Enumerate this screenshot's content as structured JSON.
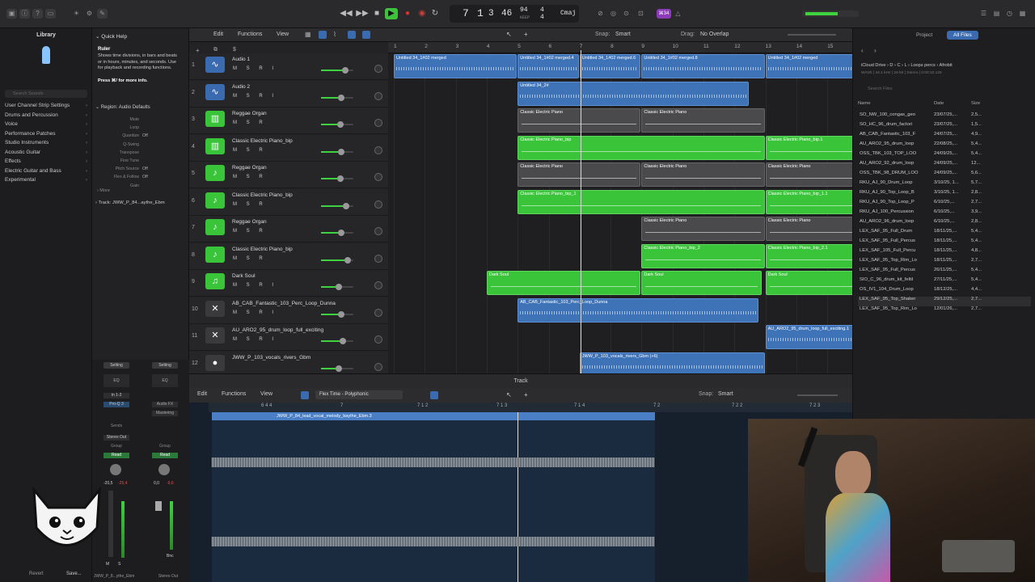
{
  "control_bar": {
    "lcd": {
      "bar": "7",
      "beat": "1",
      "div": "3",
      "tempo": "46",
      "tempo_value": "94",
      "tempo_label": "KEEP",
      "sig_top": "4",
      "sig_bottom": "4",
      "key": "Cmaj"
    },
    "badge": "⌘34"
  },
  "library": {
    "title": "Library",
    "search_placeholder": "Search Sounds",
    "items": [
      "User Channel Strip Settings",
      "Drums and Percussion",
      "Voice",
      "Performance Patches",
      "Studio Instruments",
      "Acoustic Guitar",
      "Effects",
      "Electric Guitar and Bass",
      "Experimental"
    ],
    "footer": {
      "revert": "Revert",
      "save": "Save..."
    }
  },
  "quick_help": {
    "title": "Quick Help",
    "heading": "Ruler",
    "body": "Shows time divisions, in bars and beats or in hours, minutes, and seconds. Use for playback and recording functions.",
    "more": "Press ⌘/ for more info.",
    "region_label": "Region: Audio Defaults",
    "params": [
      {
        "label": "Mute",
        "value": ""
      },
      {
        "label": "Loop",
        "value": ""
      },
      {
        "label": "Quantize",
        "value": "Off"
      },
      {
        "label": "Q-Swing",
        "value": ""
      },
      {
        "label": "Transpose",
        "value": ""
      },
      {
        "label": "Fine Tune",
        "value": ""
      },
      {
        "label": "Pitch Source",
        "value": "Off"
      },
      {
        "label": "Flex & Follow",
        "value": "Off"
      },
      {
        "label": "Gain",
        "value": ""
      }
    ],
    "more_label": "More",
    "track_label": "Track: JWW_P_84...aythe_Ebm"
  },
  "tracks_toolbar": {
    "edit": "Edit",
    "functions": "Functions",
    "view": "View",
    "snap_label": "Snap:",
    "snap_value": "Smart",
    "drag_label": "Drag:",
    "drag_value": "No Overlap"
  },
  "ruler_ticks": [
    "1",
    "2",
    "3",
    "4",
    "5",
    "6",
    "7",
    "8",
    "9",
    "10",
    "11",
    "12",
    "13",
    "14",
    "15"
  ],
  "tracks": [
    {
      "num": "1",
      "name": "Audio 1",
      "btns": "M S R I",
      "kind": "audio"
    },
    {
      "num": "2",
      "name": "Audio 2",
      "btns": "M S R I",
      "kind": "audio"
    },
    {
      "num": "3",
      "name": "Reggae Organ",
      "btns": "M S R",
      "kind": "keys"
    },
    {
      "num": "4",
      "name": "Classic Electric Piano_bip",
      "btns": "M S R",
      "kind": "keys"
    },
    {
      "num": "5",
      "name": "Reggae Organ",
      "btns": "M S R",
      "kind": "note"
    },
    {
      "num": "6",
      "name": "Classic Electric Piano_bip",
      "btns": "M S R",
      "kind": "note"
    },
    {
      "num": "7",
      "name": "Reggae Organ",
      "btns": "M S R",
      "kind": "note"
    },
    {
      "num": "8",
      "name": "Classic Electric Piano_bip",
      "btns": "M S R",
      "kind": "note"
    },
    {
      "num": "9",
      "name": "Dark Soul",
      "btns": "M S R I",
      "kind": "guitar"
    },
    {
      "num": "10",
      "name": "AB_CAB_Fantastic_103_Perc_Loop_Dunna",
      "btns": "M S R I",
      "kind": "loop"
    },
    {
      "num": "11",
      "name": "AU_ARO2_95_drum_loop_full_exciting",
      "btns": "M S R I",
      "kind": "loop"
    },
    {
      "num": "12",
      "name": "JWW_P_103_vocals_rivers_Gbm",
      "btns": "",
      "kind": "mic"
    }
  ],
  "regions": [
    {
      "row": 0,
      "from": 1,
      "to": 5,
      "color": "blue",
      "label": "Untitled 34_1#02 merged"
    },
    {
      "row": 0,
      "from": 5,
      "to": 7,
      "color": "blue",
      "label": "Untitled 34_1#02 merged.4"
    },
    {
      "row": 0,
      "from": 7,
      "to": 9,
      "color": "blue",
      "label": "Untitled 34_1#02 merged.6"
    },
    {
      "row": 0,
      "from": 9,
      "to": 13,
      "color": "blue",
      "label": "Untitled 34_1#02 merged.8"
    },
    {
      "row": 0,
      "from": 13,
      "to": 16,
      "color": "blue",
      "label": "Untitled 34_1#02 merged"
    },
    {
      "row": 1,
      "from": 5,
      "to": 12.5,
      "color": "blue",
      "label": "Untitled 34_2#"
    },
    {
      "row": 2,
      "from": 5,
      "to": 9,
      "color": "grey",
      "label": "Classic Electric Piano"
    },
    {
      "row": 2,
      "from": 9,
      "to": 13,
      "color": "grey",
      "label": "Classic Electric Piano"
    },
    {
      "row": 3,
      "from": 5,
      "to": 13,
      "color": "green",
      "label": "Classic Electric Piano_bip"
    },
    {
      "row": 3,
      "from": 13,
      "to": 16,
      "color": "green",
      "label": "Classic Electric Piano_bip.1"
    },
    {
      "row": 4,
      "from": 5,
      "to": 9,
      "color": "grey",
      "label": "Classic Electric Piano"
    },
    {
      "row": 4,
      "from": 9,
      "to": 13,
      "color": "grey",
      "label": "Classic Electric Piano"
    },
    {
      "row": 4,
      "from": 13,
      "to": 16,
      "color": "grey",
      "label": "Classic Electric Piano"
    },
    {
      "row": 5,
      "from": 5,
      "to": 13,
      "color": "green",
      "label": "Classic Electric Piano_bip_1"
    },
    {
      "row": 5,
      "from": 13,
      "to": 16,
      "color": "green",
      "label": "Classic Electric Piano_bip_1.1"
    },
    {
      "row": 6,
      "from": 9,
      "to": 13,
      "color": "grey",
      "label": "Classic Electric Piano"
    },
    {
      "row": 6,
      "from": 13,
      "to": 16,
      "color": "grey",
      "label": "Classic Electric Piano"
    },
    {
      "row": 7,
      "from": 9,
      "to": 13,
      "color": "green",
      "label": "Classic Electric Piano_bip_2"
    },
    {
      "row": 7,
      "from": 13,
      "to": 16,
      "color": "green",
      "label": "Classic Electric Piano_bip_2.1"
    },
    {
      "row": 8,
      "from": 4,
      "to": 9,
      "color": "green",
      "label": "Dark Soul"
    },
    {
      "row": 8,
      "from": 9,
      "to": 12.9,
      "color": "green",
      "label": "Dark Soul"
    },
    {
      "row": 8,
      "from": 13,
      "to": 16,
      "color": "green",
      "label": "Dark Soul"
    },
    {
      "row": 9,
      "from": 5,
      "to": 12.8,
      "color": "blue",
      "label": "AB_CAB_Fantastic_103_Perc_Loop_Dunna"
    },
    {
      "row": 10,
      "from": 13,
      "to": 16,
      "color": "blue",
      "label": "AU_ARO2_95_drum_loop_full_exciting.1"
    },
    {
      "row": 11,
      "from": 7,
      "to": 13,
      "color": "blue",
      "label": "JWW_P_103_vocals_rivers_Gbm (+6)"
    }
  ],
  "browser": {
    "tabs": [
      "Project",
      "All Files"
    ],
    "path": "iCloud Drive › D › C › L › Loops percs › Afrobit",
    "info": "WAVE | 44.1 kHz | 24-bit | Stereo | 0:00:10.125",
    "search_placeholder": "Search Files",
    "columns": [
      "Name",
      "Date",
      "Size"
    ],
    "files": [
      [
        "SO_NW_100_congas_geo",
        "23/07/25,...",
        "2,5..."
      ],
      [
        "SO_HC_96_drum_factori",
        "23/07/25,...",
        "1,5..."
      ],
      [
        "AB_CAB_Fantastic_103_F",
        "24/07/25,...",
        "4,9..."
      ],
      [
        "AU_ARO2_95_drum_loop",
        "22/08/25,...",
        "5,4..."
      ],
      [
        "OSS_TBK_103_TOP_LOO",
        "24/09/25,...",
        "5,4..."
      ],
      [
        "AU_ARO2_92_drum_loop",
        "24/09/25,...",
        "12..."
      ],
      [
        "OSS_TBK_98_DRUM_LOO",
        "24/09/25,...",
        "5,6..."
      ],
      [
        "RKU_AJ_90_Drum_Loop",
        "3/10/25, 1...",
        "5,7..."
      ],
      [
        "RKU_AJ_90_Top_Loop_B",
        "3/10/25, 1...",
        "2,8..."
      ],
      [
        "RKU_AJ_90_Top_Loop_P",
        "6/10/25,...",
        "2,7..."
      ],
      [
        "RKU_AJ_100_Percussion",
        "6/10/25,...",
        "3,9..."
      ],
      [
        "AU_ARO2_96_drum_loop",
        "6/10/25,...",
        "2,8..."
      ],
      [
        "LEX_SAF_95_Full_Drum",
        "18/11/25,...",
        "5,4..."
      ],
      [
        "LEX_SAF_95_Full_Percus",
        "18/11/25,...",
        "5,4..."
      ],
      [
        "LEX_SAF_105_Full_Percu",
        "18/11/25,...",
        "4,8..."
      ],
      [
        "LEX_SAF_95_Top_Rim_Lo",
        "18/11/25,...",
        "2,7..."
      ],
      [
        "LEX_SAF_95_Full_Percus",
        "26/11/25,...",
        "5,4..."
      ],
      [
        "SIO_C_96_drum_kit_feltil",
        "27/11/25,...",
        "5,4..."
      ],
      [
        "OS_IV1_104_Drum_Loop",
        "18/12/25,...",
        "4,4..."
      ],
      [
        "LEX_SAF_95_Top_Shaker",
        "29/12/25,...",
        "2,7..."
      ],
      [
        "LEX_SAF_95_Top_Rim_Lo",
        "12/01/26,...",
        "2,7..."
      ]
    ]
  },
  "editor": {
    "title": "Track",
    "edit": "Edit",
    "functions": "Functions",
    "view": "View",
    "mode": "Flex Time - Polyphonic",
    "snap_label": "Snap:",
    "snap_value": "Smart",
    "ruler": [
      "6 4 4",
      "7",
      "7 1 2",
      "7 1 3",
      "7 1 4",
      "7 2",
      "7 2 2",
      "7 2 3"
    ],
    "region_name": "JWW_P_84_lead_vocal_melody_baythe_Ebm.3"
  },
  "mixer": {
    "strip1": {
      "setting": "Setting",
      "eq": "EQ",
      "input": "In 1-2",
      "plugin": "Pro-Q 3",
      "sends": "Sends",
      "output": "Stereo Out",
      "group": "Group",
      "auto": "Read",
      "db1": "-20,5",
      "db2": "-25,4",
      "name": "JWW_P_8...ythe_Ebm",
      "m": "M",
      "s": "S"
    },
    "strip2": {
      "setting": "Setting",
      "eq": "EQ",
      "plugin1": "Audio FX",
      "plugin2": "Mastering",
      "group": "Group",
      "auto": "Read",
      "db1": "0,0",
      "db2": "-9,6",
      "bnc": "Bnc",
      "name": "Stereo Out"
    }
  }
}
